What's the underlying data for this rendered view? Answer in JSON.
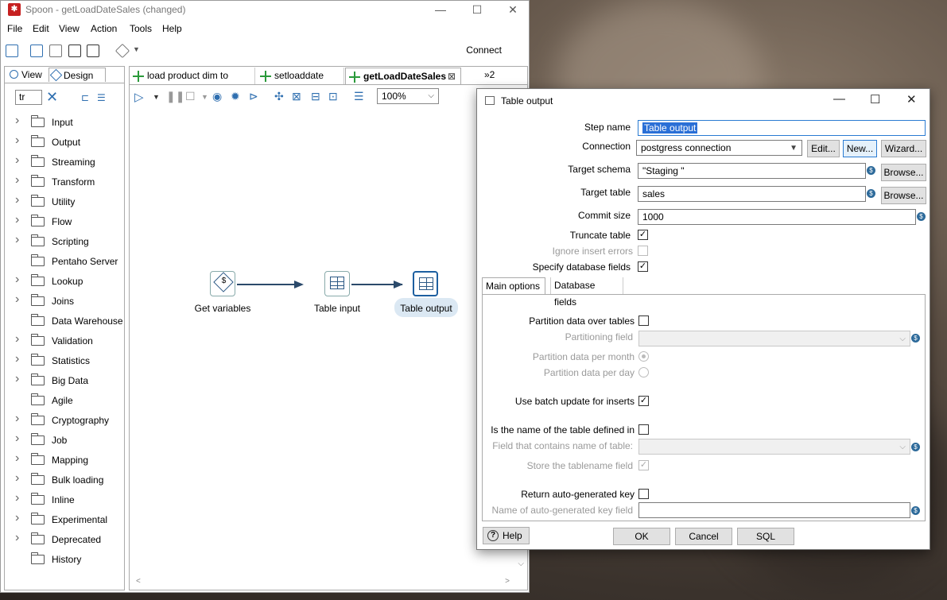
{
  "window": {
    "title": "Spoon - getLoadDateSales (changed)"
  },
  "menu": [
    "File",
    "Edit",
    "View",
    "Action",
    "Tools",
    "Help"
  ],
  "toolbar": {
    "connect_label": "Connect"
  },
  "left_panel": {
    "tabs": [
      "View",
      "Design"
    ],
    "search_value": "tr",
    "tree_items": [
      {
        "label": "Input",
        "expandable": true
      },
      {
        "label": "Output",
        "expandable": true
      },
      {
        "label": "Streaming",
        "expandable": true
      },
      {
        "label": "Transform",
        "expandable": true
      },
      {
        "label": "Utility",
        "expandable": true
      },
      {
        "label": "Flow",
        "expandable": true
      },
      {
        "label": "Scripting",
        "expandable": true
      },
      {
        "label": "Pentaho Server",
        "expandable": false
      },
      {
        "label": "Lookup",
        "expandable": true
      },
      {
        "label": "Joins",
        "expandable": true
      },
      {
        "label": "Data Warehouse",
        "expandable": false
      },
      {
        "label": "Validation",
        "expandable": true
      },
      {
        "label": "Statistics",
        "expandable": true
      },
      {
        "label": "Big Data",
        "expandable": true
      },
      {
        "label": "Agile",
        "expandable": false
      },
      {
        "label": "Cryptography",
        "expandable": true
      },
      {
        "label": "Job",
        "expandable": true
      },
      {
        "label": "Mapping",
        "expandable": true
      },
      {
        "label": "Bulk loading",
        "expandable": true
      },
      {
        "label": "Inline",
        "expandable": true
      },
      {
        "label": "Experimental",
        "expandable": true
      },
      {
        "label": "Deprecated",
        "expandable": true
      },
      {
        "label": "History",
        "expandable": false
      }
    ]
  },
  "doc_tabs": [
    {
      "label": "load product dim to"
    },
    {
      "label": "setloaddate"
    },
    {
      "label": "getLoadDateSales"
    }
  ],
  "more_tabs": "»2",
  "zoom": "100%",
  "steps": {
    "get_variables": "Get variables",
    "table_input": "Table input",
    "table_output": "Table output"
  },
  "dialog": {
    "title": "Table output",
    "step_name_label": "Step name",
    "step_name_value": "Table output",
    "connection_label": "Connection",
    "connection_value": "postgress connection",
    "edit_label": "Edit...",
    "new_label": "New...",
    "wizard_label": "Wizard...",
    "target_schema_label": "Target schema",
    "target_schema_value": "\"Staging \"",
    "target_table_label": "Target table",
    "target_table_value": "sales",
    "browse_label": "Browse...",
    "commit_size_label": "Commit size",
    "commit_size_value": "1000",
    "truncate_label": "Truncate table",
    "truncate_checked": true,
    "ignore_errors_label": "Ignore insert errors",
    "specify_fields_label": "Specify database fields",
    "specify_fields_checked": true,
    "tabs": [
      "Main options",
      "Database fields"
    ],
    "partition_label": "Partition data over tables",
    "partition_field_label": "Partitioning field",
    "per_month_label": "Partition data per month",
    "per_day_label": "Partition data per day",
    "batch_label": "Use batch update for inserts",
    "batch_checked": true,
    "name_in_field_label": "Is the name of the table defined in",
    "field_name_label": "Field that contains name of table:",
    "store_name_label": "Store the tablename field",
    "return_key_label": "Return auto-generated key",
    "key_field_label": "Name of auto-generated key field",
    "help_label": "Help",
    "ok_label": "OK",
    "cancel_label": "Cancel",
    "sql_label": "SQL"
  }
}
